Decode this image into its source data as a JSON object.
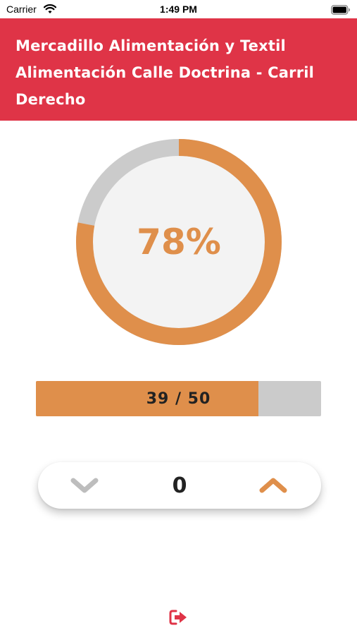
{
  "status_bar": {
    "carrier": "Carrier",
    "time": "1:49 PM"
  },
  "header": {
    "title_line1": "Mercadillo Alimentación y Textil",
    "title_line2": "Alimentación Calle Doctrina - Carril",
    "title_line3": "Derecho"
  },
  "occupancy": {
    "percent_label": "78%",
    "percent": 78,
    "current": 39,
    "total": 50,
    "bar_label": "39 / 50"
  },
  "stepper": {
    "value": "0"
  },
  "colors": {
    "header": "#df3447",
    "accent": "#df8f4b",
    "track": "#cbcbcb",
    "muted": "#bdbdbd"
  },
  "icons": {
    "status": [
      "wifi-icon",
      "battery-icon"
    ],
    "stepper": [
      "chevron-down-icon",
      "chevron-up-icon"
    ],
    "footer": "logout-icon"
  }
}
